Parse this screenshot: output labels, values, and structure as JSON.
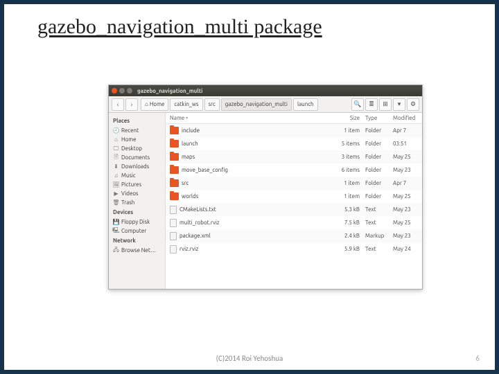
{
  "slide": {
    "title": "gazebo_navigation_multi package",
    "footer": "(C)2014 Roi Yehoshua",
    "page_number": "6"
  },
  "window": {
    "title": "gazebo_navigation_multi",
    "breadcrumbs": [
      "Home",
      "catkin_ws",
      "src",
      "gazebo_navigation_multi",
      "launch"
    ],
    "toolbar": {
      "search_placeholder": ""
    }
  },
  "sidebar": {
    "sections": [
      {
        "head": "Places",
        "items": [
          {
            "icon": "🕘",
            "label": "Recent"
          },
          {
            "icon": "⌂",
            "label": "Home"
          },
          {
            "icon": "🖵",
            "label": "Desktop"
          },
          {
            "icon": "🗎",
            "label": "Documents"
          },
          {
            "icon": "⬇",
            "label": "Downloads"
          },
          {
            "icon": "♫",
            "label": "Music"
          },
          {
            "icon": "🖼",
            "label": "Pictures"
          },
          {
            "icon": "▶",
            "label": "Videos"
          },
          {
            "icon": "🗑",
            "label": "Trash"
          }
        ]
      },
      {
        "head": "Devices",
        "items": [
          {
            "icon": "💾",
            "label": "Floppy Disk"
          },
          {
            "icon": "🖳",
            "label": "Computer"
          }
        ]
      },
      {
        "head": "Network",
        "items": [
          {
            "icon": "🖧",
            "label": "Browse Net…"
          }
        ]
      }
    ]
  },
  "columns": [
    "Name",
    "Size",
    "Type",
    "Modified"
  ],
  "files": [
    {
      "kind": "folder",
      "name": "include",
      "size": "1 item",
      "type": "Folder",
      "modified": "Apr 7"
    },
    {
      "kind": "folder",
      "name": "launch",
      "size": "5 items",
      "type": "Folder",
      "modified": "03:51"
    },
    {
      "kind": "folder",
      "name": "maps",
      "size": "3 items",
      "type": "Folder",
      "modified": "May 25"
    },
    {
      "kind": "folder",
      "name": "move_base_config",
      "size": "6 items",
      "type": "Folder",
      "modified": "May 23"
    },
    {
      "kind": "folder",
      "name": "src",
      "size": "1 item",
      "type": "Folder",
      "modified": "Apr 7"
    },
    {
      "kind": "folder",
      "name": "worlds",
      "size": "1 item",
      "type": "Folder",
      "modified": "May 25"
    },
    {
      "kind": "file",
      "name": "CMakeLists.txt",
      "size": "5.3 kB",
      "type": "Text",
      "modified": "May 23"
    },
    {
      "kind": "file",
      "name": "multi_robot.rviz",
      "size": "7.5 kB",
      "type": "Text",
      "modified": "May 25"
    },
    {
      "kind": "file",
      "name": "package.xml",
      "size": "2.4 kB",
      "type": "Markup",
      "modified": "May 23"
    },
    {
      "kind": "file",
      "name": "rviz.rviz",
      "size": "5.9 kB",
      "type": "Text",
      "modified": "May 24"
    }
  ]
}
